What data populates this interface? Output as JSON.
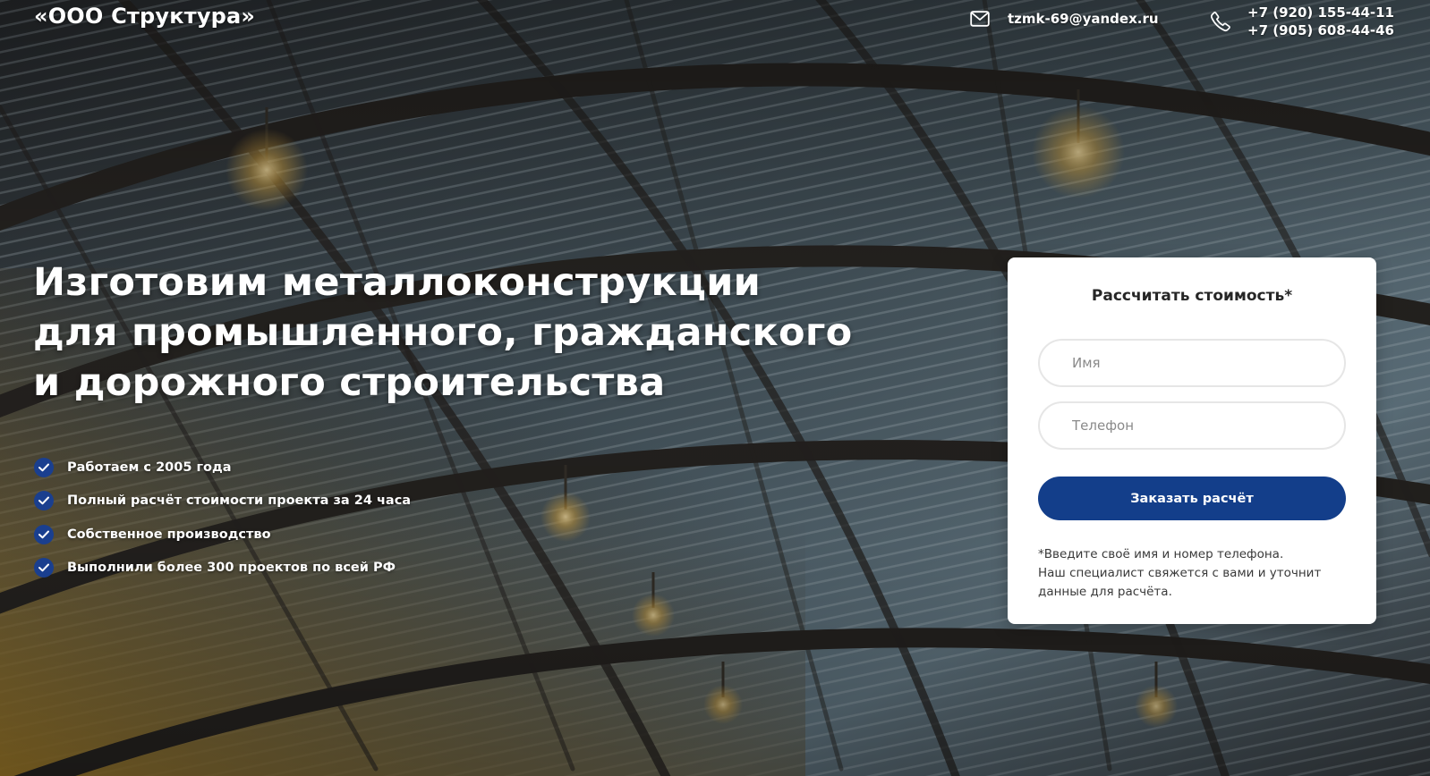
{
  "header": {
    "logo": "«ООО Структура»",
    "email": "tzmk-69@yandex.ru",
    "phones": [
      "+7 (920) 155-44-11",
      "+7 (905) 608-44-46"
    ],
    "icons": {
      "email": "mail-icon",
      "phone": "phone-icon"
    }
  },
  "hero": {
    "headline_lines": [
      "Изготовим металлоконструкции",
      "для промышленного, гражданского",
      "и дорожного строительства"
    ],
    "features": [
      "Работаем с 2005 года",
      "Полный расчёт стоимости проекта за 24 часа",
      "Собственное производство",
      "Выполнили более 300 проектов по всей РФ"
    ],
    "feature_icon": "check-circle-icon"
  },
  "form": {
    "title": "Рассчитать стоимость*",
    "name_placeholder": "Имя",
    "phone_placeholder": "Телефон",
    "submit_label": "Заказать расчёт",
    "note_lines": [
      "*Введите своё имя и номер телефона.",
      "Наш специалист свяжется с вами и уточнит",
      "данные для расчёта."
    ]
  },
  "colors": {
    "accent": "#133e8a",
    "check_bg": "#1a3f8f",
    "card_bg": "#ffffff",
    "text_light": "#ffffff"
  }
}
